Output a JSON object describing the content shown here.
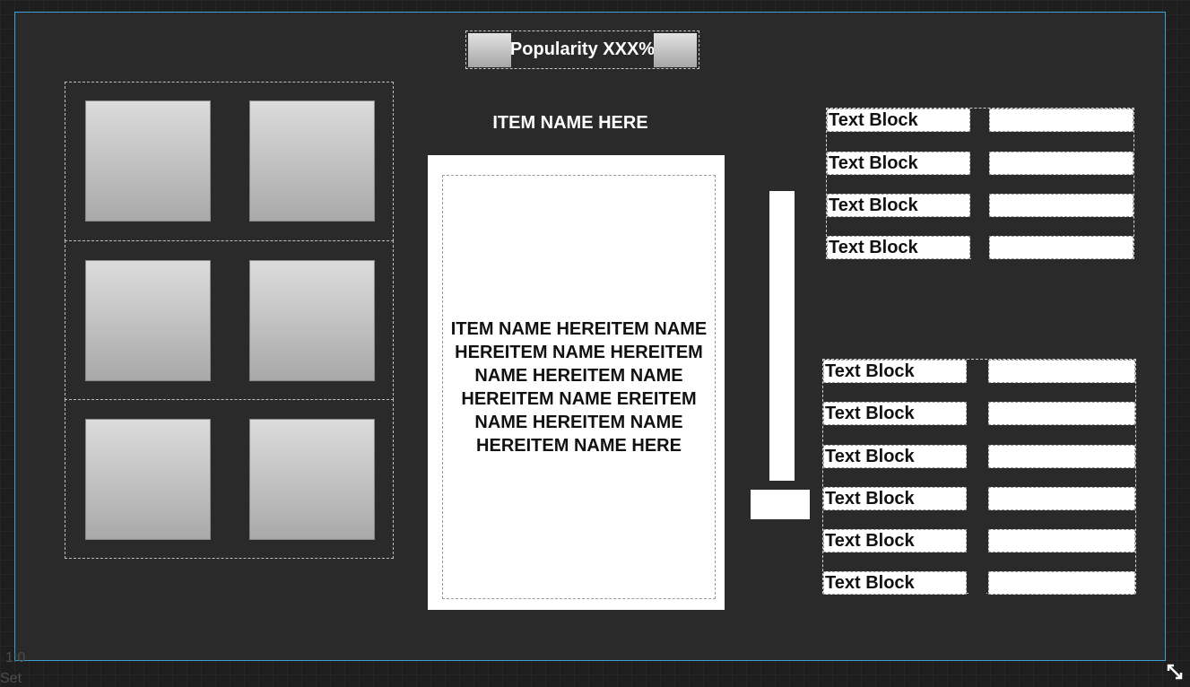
{
  "header": {
    "popularity": "Popularity XXX%"
  },
  "item": {
    "name": "ITEM NAME HERE",
    "description": "ITEM NAME HEREITEM NAME HEREITEM NAME HEREITEM NAME HEREITEM NAME HEREITEM NAME EREITEM NAME HEREITEM NAME HEREITEM NAME HERE"
  },
  "stats_top": [
    "Text Block",
    "Text Block",
    "Text Block",
    "Text Block"
  ],
  "stats_bottom": [
    "Text Block",
    "Text Block",
    "Text Block",
    "Text Block",
    "Text Block",
    "Text Block"
  ],
  "viewport": {
    "scale": "1:0",
    "label": "Set"
  },
  "icons": {
    "resize": "resize-diagonal-icon"
  },
  "colors": {
    "selection_border": "#3aa0d8",
    "canvas": "#2a2a2a",
    "tile": "#c4c4c4"
  }
}
